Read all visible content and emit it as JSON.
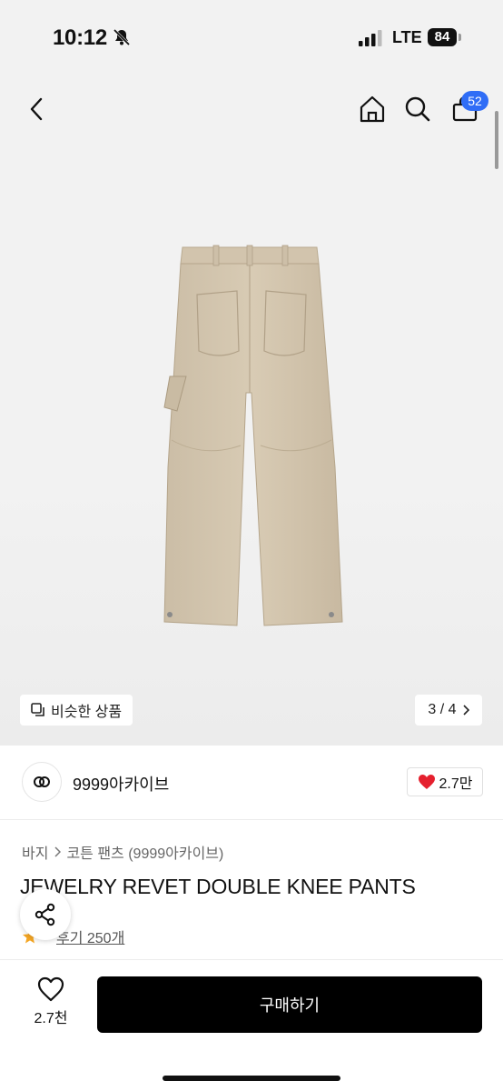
{
  "status_bar": {
    "time": "10:12",
    "network": "LTE",
    "battery": "84"
  },
  "nav": {
    "cart_count": "52"
  },
  "gallery": {
    "similar_label": "비슷한 상품",
    "pager": "3 / 4"
  },
  "brand": {
    "name": "9999아카이브",
    "likes": "2.7만"
  },
  "product": {
    "breadcrumb": [
      "바지",
      "코튼 팬츠 (9999아카이브)"
    ],
    "title": "JEWELRY REVET DOUBLE KNEE PANTS",
    "review_label": "후기 250개"
  },
  "bottom": {
    "wish_count": "2.7천",
    "buy_label": "구매하기"
  },
  "colors": {
    "accent_badge": "#2f6df6",
    "heart": "#e5202e",
    "buy_button": "#000000",
    "star": "#f5a623"
  }
}
